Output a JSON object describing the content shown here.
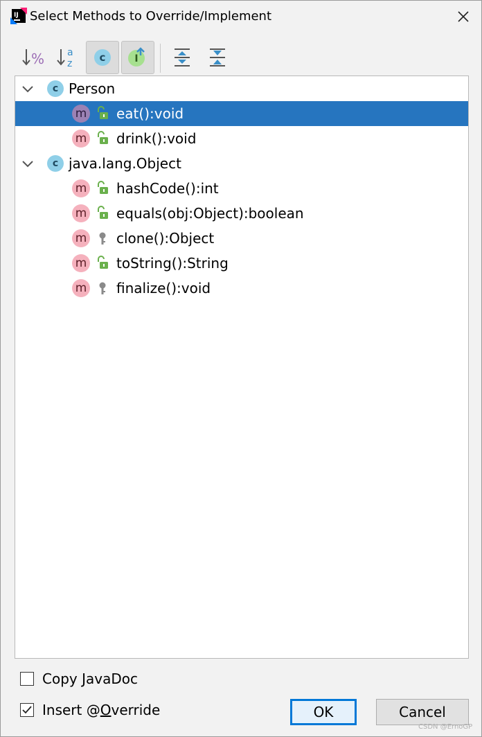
{
  "window": {
    "title": "Select Methods to Override/Implement",
    "logo_text": "IJ"
  },
  "toolbar": {
    "buttons": [
      {
        "name": "sort-by-visibility-icon",
        "pressed": false
      },
      {
        "name": "sort-alphabetically-icon",
        "pressed": false
      },
      {
        "name": "show-classes-icon",
        "pressed": true
      },
      {
        "name": "show-interfaces-icon",
        "pressed": true
      },
      {
        "name": "expand-all-icon",
        "pressed": false
      },
      {
        "name": "collapse-all-icon",
        "pressed": false
      }
    ],
    "sort_visibility_glyph": "%",
    "sort_alpha_top": "a",
    "sort_alpha_bottom": "z",
    "class_glyph": "c",
    "interface_glyph": "I"
  },
  "tree": {
    "groups": [
      {
        "label": "Person",
        "icon_glyph": "c",
        "methods": [
          {
            "label": "eat():void",
            "access": "public",
            "selected": true
          },
          {
            "label": "drink():void",
            "access": "public",
            "selected": false
          }
        ]
      },
      {
        "label": "java.lang.Object",
        "icon_glyph": "c",
        "methods": [
          {
            "label": "hashCode():int",
            "access": "public",
            "selected": false
          },
          {
            "label": "equals(obj:Object):boolean",
            "access": "public",
            "selected": false
          },
          {
            "label": "clone():Object",
            "access": "protected",
            "selected": false
          },
          {
            "label": "toString():String",
            "access": "public",
            "selected": false
          },
          {
            "label": "finalize():void",
            "access": "protected",
            "selected": false
          }
        ]
      }
    ],
    "method_glyph": "m"
  },
  "options": {
    "copy_javadoc": {
      "label_pre": "Copy ",
      "label_u": "J",
      "label_post": "avaDoc",
      "checked": false
    },
    "insert_override": {
      "label_pre": "Insert @",
      "label_u": "O",
      "label_post": "verride",
      "checked": true
    }
  },
  "buttons": {
    "ok": "OK",
    "cancel": "Cancel"
  },
  "watermark": "CSDN @ErnoGP",
  "colors": {
    "selection": "#2675bf",
    "class_icon": "#8fcfe8",
    "method_icon": "#f5b1bd",
    "public_lock": "#6ab04c",
    "protected_key": "#8a8a8a",
    "default_button_border": "#0078d7"
  }
}
